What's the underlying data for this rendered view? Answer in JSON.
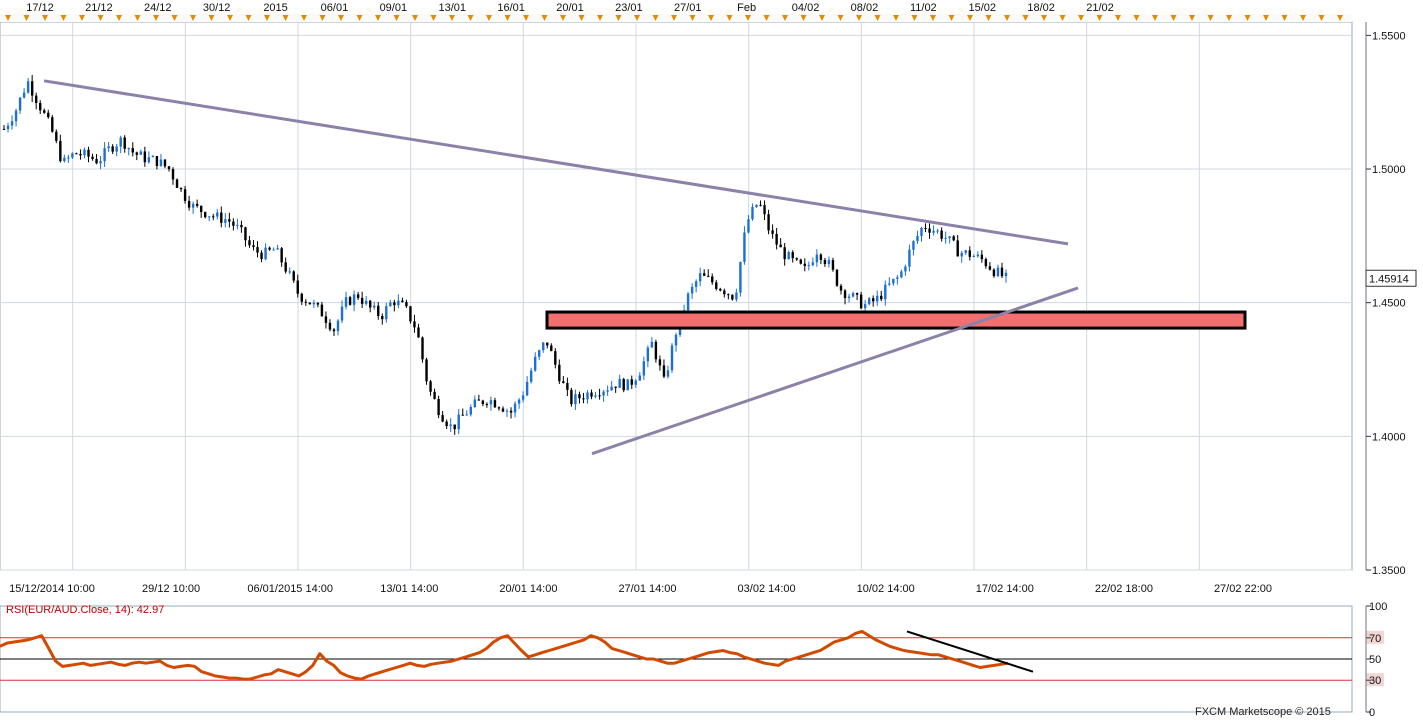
{
  "chart_data": [
    {
      "type": "candlestick",
      "pair": "EUR/AUD",
      "event_dates": [
        "17/12",
        "21/12",
        "24/12",
        "30/12",
        "2015",
        "06/01",
        "09/01",
        "13/01",
        "16/01",
        "20/01",
        "23/01",
        "27/01",
        "Feb",
        "04/02",
        "08/02",
        "11/02",
        "15/02",
        "18/02",
        "21/02"
      ],
      "x_ticks": [
        "15/12/2014 10:00",
        "29/12 10:00",
        "06/01/2015 14:00",
        "13/01 14:00",
        "20/01 14:00",
        "27/01 14:00",
        "03/02 14:00",
        "10/02 14:00",
        "17/02 14:00",
        "22/02 18:00",
        "27/02 22:00"
      ],
      "y_ticks": [
        "1.5500",
        "1.5000",
        "1.4500",
        "1.4000",
        "1.3500"
      ],
      "ylim": [
        1.35,
        1.555
      ],
      "last_price": "1.45914",
      "price_path": [
        1.515,
        1.522,
        1.533,
        1.524,
        1.515,
        1.502,
        1.506,
        1.505,
        1.503,
        1.508,
        1.511,
        1.506,
        1.504,
        1.503,
        1.5,
        1.492,
        1.486,
        1.484,
        1.482,
        1.481,
        1.477,
        1.47,
        1.468,
        1.47,
        1.462,
        1.453,
        1.45,
        1.446,
        1.44,
        1.45,
        1.453,
        1.448,
        1.445,
        1.451,
        1.448,
        1.44,
        1.418,
        1.409,
        1.403,
        1.408,
        1.412,
        1.414,
        1.412,
        1.409,
        1.416,
        1.428,
        1.436,
        1.424,
        1.413,
        1.415,
        1.417,
        1.418,
        1.42,
        1.419,
        1.425,
        1.435,
        1.42,
        1.439,
        1.452,
        1.46,
        1.458,
        1.455,
        1.452,
        1.48,
        1.488,
        1.476,
        1.469,
        1.465,
        1.462,
        1.47,
        1.464,
        1.455,
        1.452,
        1.449,
        1.451,
        1.456,
        1.46,
        1.471,
        1.479,
        1.477,
        1.474,
        1.469,
        1.468,
        1.466,
        1.462,
        1.459
      ],
      "downtrend_line": {
        "from": [
          "15/12",
          1.533
        ],
        "to": [
          "19/02",
          1.472
        ]
      },
      "uptrend_line": {
        "from": [
          "22/01",
          1.3935
        ],
        "to": [
          "19/02",
          1.4555
        ]
      },
      "support_zone": [
        1.4405,
        1.4465
      ],
      "colors": {
        "up": "#1a6fd8",
        "down": "#000000",
        "trendline": "#8c82a8",
        "zone_fill": "#f26f6f",
        "zone_border": "#000000",
        "event_marker": "#e38c00",
        "grid": "#cfd8e2"
      }
    },
    {
      "type": "line",
      "title": "RSI(EUR/AUD.Close, 14): 42.97",
      "levels": [
        100,
        70,
        50,
        30,
        0
      ],
      "ylim": [
        0,
        100
      ],
      "values": [
        62,
        65,
        66,
        67,
        68,
        70,
        72,
        60,
        48,
        43,
        44,
        45,
        46,
        44,
        45,
        46,
        47,
        45,
        44,
        46,
        47,
        46,
        47,
        48,
        44,
        42,
        43,
        44,
        43,
        38,
        36,
        34,
        33,
        32,
        32,
        31,
        31,
        33,
        35,
        36,
        40,
        38,
        36,
        34,
        38,
        44,
        55,
        48,
        44,
        37,
        34,
        32,
        31,
        34,
        36,
        38,
        40,
        42,
        44,
        46,
        44,
        43,
        45,
        46,
        47,
        48,
        50,
        52,
        54,
        56,
        60,
        66,
        70,
        72,
        65,
        58,
        52,
        54,
        56,
        58,
        60,
        62,
        64,
        66,
        68,
        72,
        70,
        66,
        60,
        58,
        56,
        54,
        52,
        50,
        50,
        48,
        46,
        46,
        48,
        50,
        52,
        54,
        56,
        57,
        58,
        56,
        55,
        52,
        50,
        48,
        46,
        45,
        44,
        48,
        50,
        52,
        54,
        56,
        58,
        62,
        66,
        68,
        70,
        74,
        76,
        72,
        68,
        65,
        62,
        60,
        58,
        57,
        56,
        55,
        54,
        54,
        52,
        50,
        48,
        46,
        44,
        42,
        43,
        44,
        45,
        46
      ],
      "divergence_line": {
        "from": 76,
        "to": 38
      },
      "colors": {
        "rsi": "#d24a00",
        "level": "#e03030"
      }
    }
  ],
  "footer": {
    "copyright": "FXCM Marketscope © 2015"
  }
}
